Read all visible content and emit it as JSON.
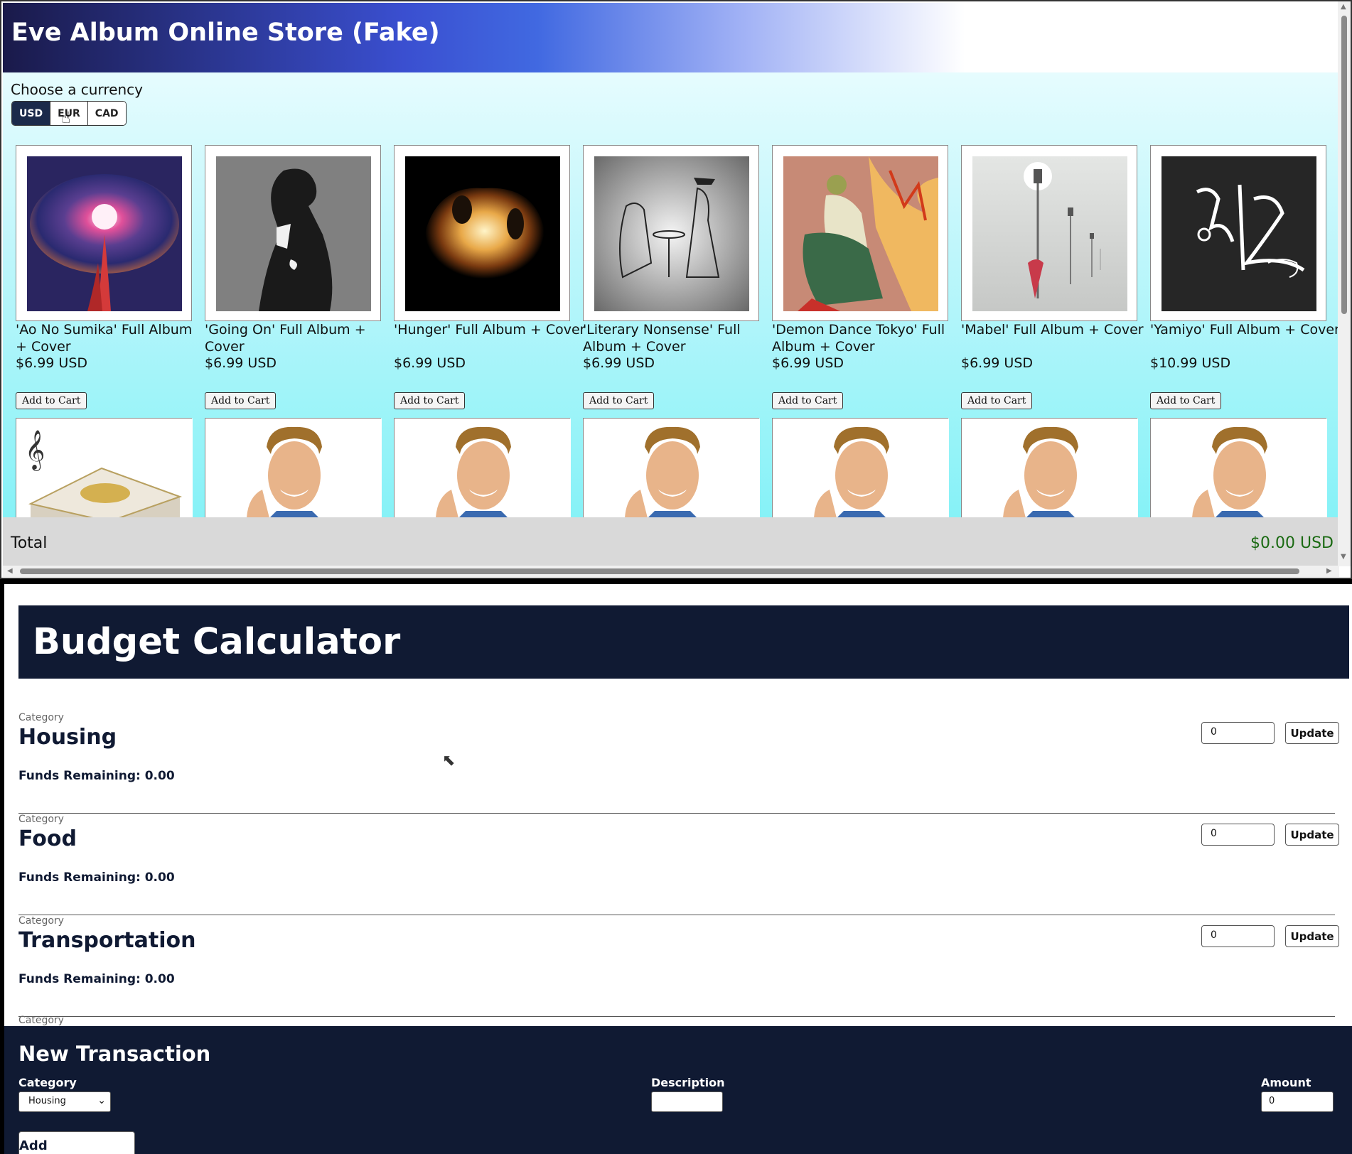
{
  "store": {
    "title": "Eve Album Online Store (Fake)",
    "currency_label": "Choose a currency",
    "currencies": [
      "USD",
      "EUR",
      "CAD"
    ],
    "selected_currency": "USD",
    "add_to_cart_label": "Add to Cart",
    "products": [
      {
        "name": "'Ao No Sumika' Full Album + Cover",
        "price": "$6.99 USD",
        "art": "eye-art"
      },
      {
        "name": "'Going On' Full Album + Cover",
        "price": "$6.99 USD",
        "art": "gray-figure-art"
      },
      {
        "name": "'Hunger' Full Album + Cover",
        "price": "$6.99 USD",
        "art": "fire-art"
      },
      {
        "name": "'Literary Nonsense' Full Album + Cover",
        "price": "$6.99 USD",
        "art": "sketch-art"
      },
      {
        "name": "'Demon Dance Tokyo' Full Album + Cover",
        "price": "$6.99 USD",
        "art": "dancer-art"
      },
      {
        "name": "'Mabel' Full Album + Cover",
        "price": "$6.99 USD",
        "art": "streetlamp-art"
      },
      {
        "name": "'Yamiyo' Full Album + Cover",
        "price": "$10.99 USD",
        "art": "calligraphy-art"
      }
    ],
    "row2_items": [
      "music-box-image",
      "stock-photo-man",
      "stock-photo-man",
      "stock-photo-man",
      "stock-photo-man",
      "stock-photo-man",
      "stock-photo-man"
    ],
    "total_label": "Total",
    "total_value": "$0.00 USD",
    "colors": {
      "total_green": "#1a6a12",
      "active_currency": "#1b2a4a"
    }
  },
  "budget": {
    "title": "Budget Calculator",
    "category_label": "Category",
    "update_label": "Update",
    "categories": [
      {
        "name": "Housing",
        "funds": "Funds Remaining: 0.00",
        "input_value": "0"
      },
      {
        "name": "Food",
        "funds": "Funds Remaining: 0.00",
        "input_value": "0"
      },
      {
        "name": "Transportation",
        "funds": "Funds Remaining: 0.00",
        "input_value": "0"
      }
    ],
    "transaction": {
      "title": "New Transaction",
      "category_label": "Category",
      "description_label": "Description",
      "amount_label": "Amount",
      "selected_category": "Housing",
      "description_value": "",
      "amount_value": "0",
      "add_label": "Add Transaction"
    },
    "colors": {
      "navy": "#101a33"
    }
  }
}
